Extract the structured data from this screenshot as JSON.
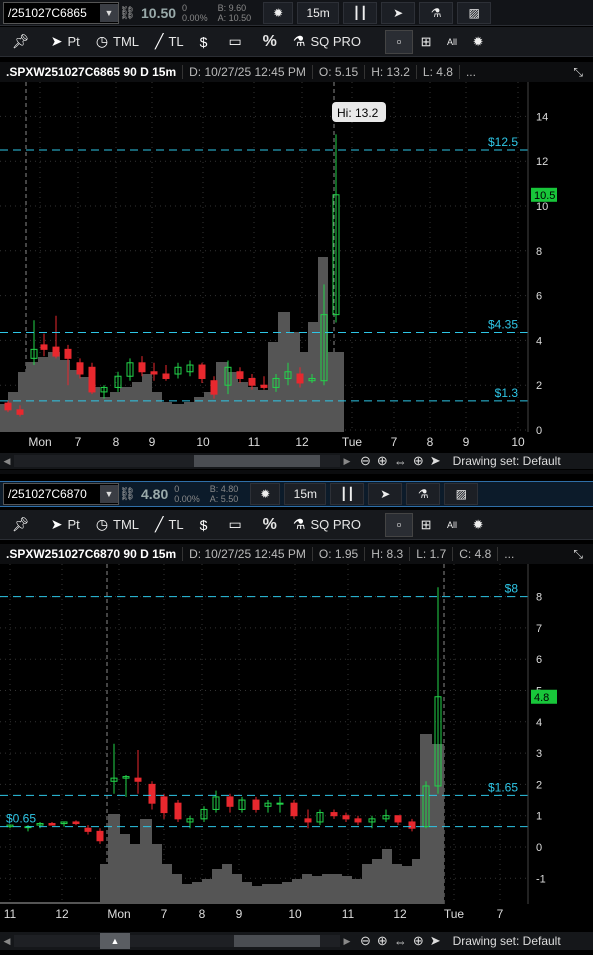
{
  "panel1": {
    "symbol": "/251027C6865",
    "last": "10.50",
    "change": [
      "0",
      "0.00%"
    ],
    "bidask": [
      "B: 9.60",
      "A: 10.50"
    ],
    "timeframe": "15m",
    "info": {
      "title": ".SPXW251027C6865 90 D 15m",
      "date": "D: 10/27/25 12:45 PM",
      "open": "O: 5.15",
      "high": "H: 13.2",
      "low": "L: 4.8",
      "more": "..."
    },
    "y_ticks": [
      "14",
      "12",
      "10",
      "8",
      "6",
      "4",
      "2",
      "0"
    ],
    "x_ticks": [
      "Mon",
      "7",
      "8",
      "9",
      "10",
      "11",
      "12",
      "Tue",
      "7",
      "8",
      "9",
      "10"
    ],
    "levels": [
      {
        "label": "$12.5",
        "value": 12.5
      },
      {
        "label": "$4.35",
        "value": 4.35
      },
      {
        "label": "$1.3",
        "value": 1.3
      }
    ],
    "price_badge": "10.5",
    "price_value": 10.5,
    "hi_bubble": "Hi: 13.2",
    "drawing_set": "Drawing set: Default"
  },
  "panel2": {
    "symbol": "/251027C6870",
    "last": "4.80",
    "change": [
      "0",
      "0.00%"
    ],
    "bidask": [
      "B: 4.80",
      "A: 5.50"
    ],
    "timeframe": "15m",
    "info": {
      "title": ".SPXW251027C6870 90 D 15m",
      "date": "D: 10/27/25 12:45 PM",
      "open": "O: 1.95",
      "high": "H: 8.3",
      "low": "L: 1.7",
      "close": "C: 4.8",
      "more": "..."
    },
    "y_ticks": [
      "8",
      "7",
      "6",
      "5",
      "4",
      "3",
      "2",
      "1",
      "0",
      "-1"
    ],
    "x_ticks": [
      "11",
      "12",
      "Mon",
      "7",
      "8",
      "9",
      "10",
      "11",
      "12",
      "Tue",
      "7"
    ],
    "levels": [
      {
        "label": "$8",
        "value": 8
      },
      {
        "label": "$1.65",
        "value": 1.65
      },
      {
        "label": "$0.65",
        "value": 0.65
      }
    ],
    "price_badge": "4.8",
    "price_value": 4.8,
    "drawing_set": "Drawing set: Default"
  },
  "toolbar": {
    "pt": "Pt",
    "tml": "TML",
    "tl": "TL",
    "pct": "%",
    "sq": "SQ PRO",
    "all": "All"
  },
  "colors": {
    "up": "#22d34a",
    "down": "#e8282e",
    "level": "#2ec6e6",
    "volume": "#555555",
    "badge": "#18c63a"
  }
}
